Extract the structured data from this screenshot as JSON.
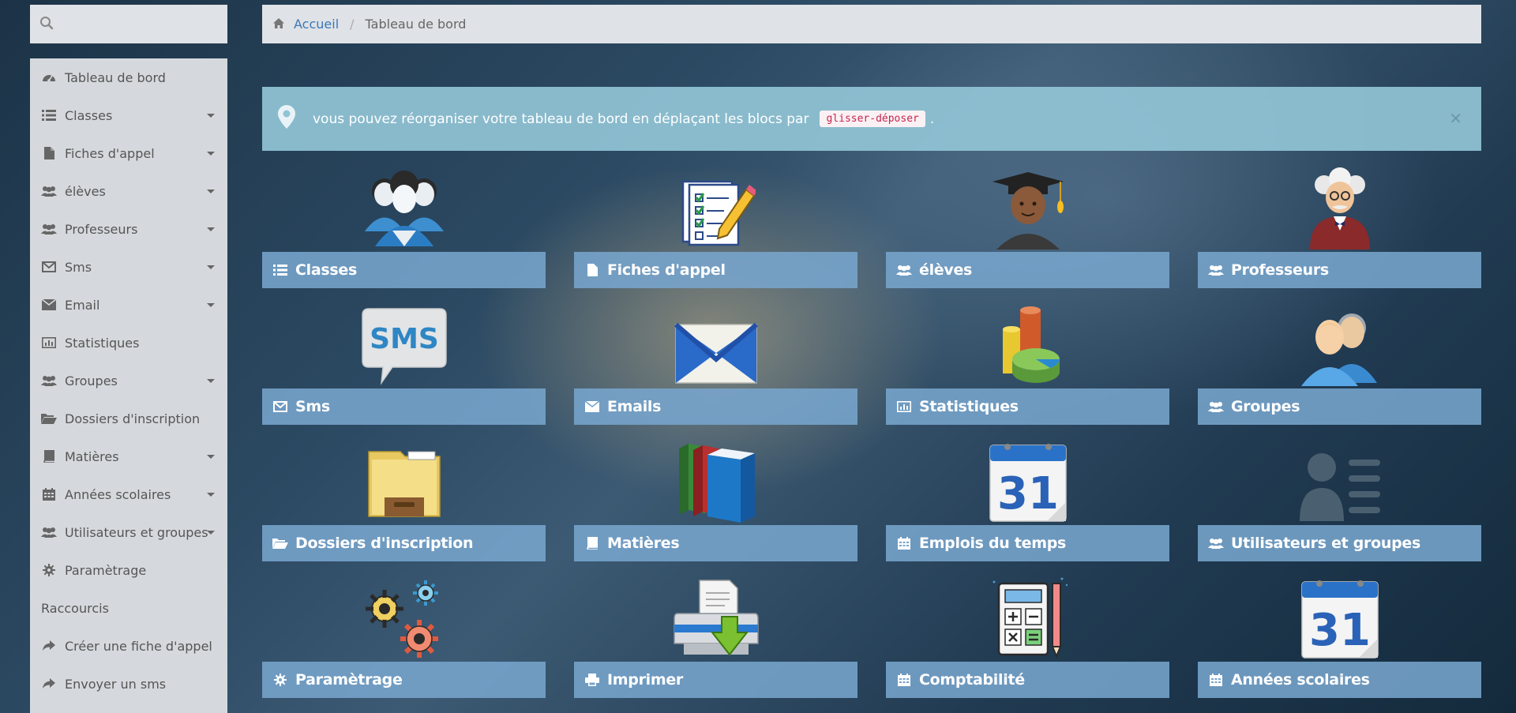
{
  "search": {
    "placeholder": ""
  },
  "sidebar": {
    "items": [
      {
        "label": "Tableau de bord",
        "icon": "dashboard-icon"
      },
      {
        "label": "Classes",
        "icon": "list-icon"
      },
      {
        "label": "Fiches d'appel",
        "icon": "file-icon"
      },
      {
        "label": "élèves",
        "icon": "users-icon"
      },
      {
        "label": "Professeurs",
        "icon": "users-icon"
      },
      {
        "label": "Sms",
        "icon": "envelope-outline-icon"
      },
      {
        "label": "Email",
        "icon": "envelope-icon"
      },
      {
        "label": "Statistiques",
        "icon": "bar-chart-icon"
      },
      {
        "label": "Groupes",
        "icon": "users-icon"
      },
      {
        "label": "Dossiers d'inscription",
        "icon": "folder-open-icon"
      },
      {
        "label": "Matières",
        "icon": "book-icon"
      },
      {
        "label": "Années scolaires",
        "icon": "calendar-icon"
      },
      {
        "label": "Utilisateurs et groupes",
        "icon": "users-icon"
      },
      {
        "label": "Paramètrage",
        "icon": "gear-icon"
      }
    ],
    "shortcuts_heading": "Raccourcis",
    "shortcuts": [
      {
        "label": "Créer une fiche d'appel",
        "icon": "share-icon"
      },
      {
        "label": "Envoyer un sms",
        "icon": "share-icon"
      }
    ]
  },
  "breadcrumb": {
    "home": "Accueil",
    "current": "Tableau de bord"
  },
  "alert": {
    "text": "vous pouvez réorganiser votre tableau de bord en déplaçant les blocs par",
    "code": "glisser-déposer",
    "suffix": "."
  },
  "tiles": [
    {
      "label": "Classes",
      "icon": "list-icon",
      "art": "students-group-icon"
    },
    {
      "label": "Fiches d'appel",
      "icon": "file-icon",
      "art": "checklist-pencil-icon"
    },
    {
      "label": "élèves",
      "icon": "users-icon",
      "art": "graduate-student-icon"
    },
    {
      "label": "Professeurs",
      "icon": "users-icon",
      "art": "professor-icon"
    },
    {
      "label": "Sms",
      "icon": "envelope-outline-icon",
      "art": "sms-bubble-icon",
      "art_text": "SMS"
    },
    {
      "label": "Emails",
      "icon": "envelope-icon",
      "art": "mail-envelope-icon"
    },
    {
      "label": "Statistiques",
      "icon": "bar-chart-icon",
      "art": "pie-chart-3d-icon"
    },
    {
      "label": "Groupes",
      "icon": "users-icon",
      "art": "user-pair-icon"
    },
    {
      "label": "Dossiers d'inscription",
      "icon": "folder-open-icon",
      "art": "file-cabinet-folder-icon"
    },
    {
      "label": "Matières",
      "icon": "book-icon",
      "art": "books-stack-icon"
    },
    {
      "label": "Emplois du temps",
      "icon": "calendar-icon",
      "art": "calendar-31-icon",
      "art_text": "31"
    },
    {
      "label": "Utilisateurs et groupes",
      "icon": "users-icon",
      "art": "user-card-icon"
    },
    {
      "label": "Paramètrage",
      "icon": "gear-icon",
      "art": "gears-icon"
    },
    {
      "label": "Imprimer",
      "icon": "print-icon",
      "art": "printer-download-icon"
    },
    {
      "label": "Comptabilité",
      "icon": "calendar-icon",
      "art": "calculator-icon"
    },
    {
      "label": "Années scolaires",
      "icon": "calendar-icon",
      "art": "calendar-31-icon",
      "art_text": "31"
    }
  ]
}
